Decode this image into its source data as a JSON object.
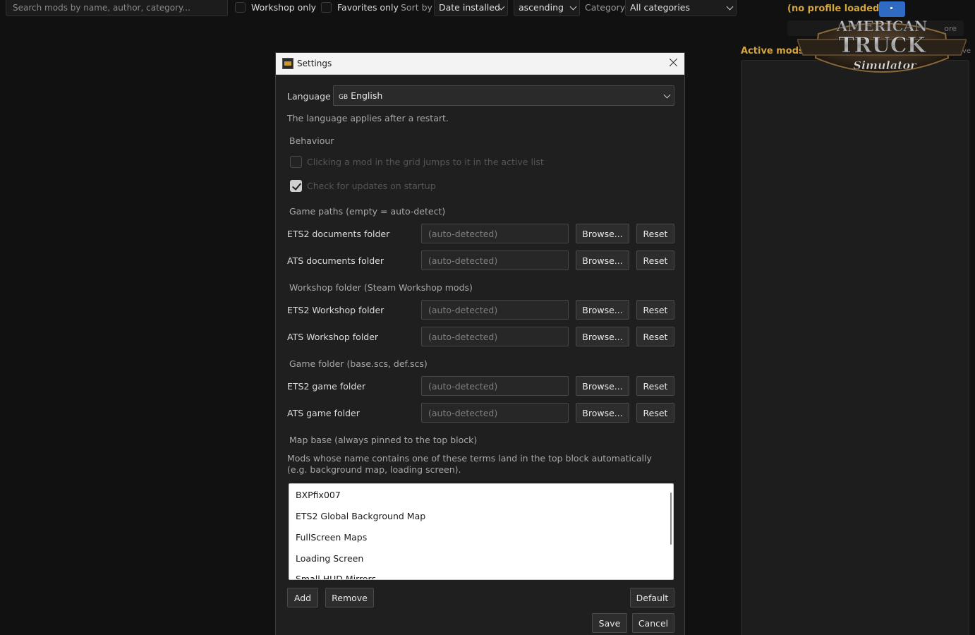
{
  "toolbar": {
    "search_placeholder": "Search mods by name, author, category...",
    "workshop_only": "Workshop only",
    "favorites_only": "Favorites only",
    "sort_by_label": "Sort by",
    "sort_by_value": "Date installed",
    "sort_order_value": "ascending",
    "category_label": "Category",
    "category_value": "All categories"
  },
  "right_panel": {
    "profile_label": "(no profile loaded)",
    "more_button": "ore",
    "active_mods_label": "Active mods",
    "active_truncated": "ve",
    "logo": {
      "line1": "AMERICAN",
      "line2": "TRUCK",
      "line3": "Simulator"
    }
  },
  "dialog": {
    "title": "Settings",
    "language_label": "Language",
    "language_flag": "GB",
    "language_value": "English",
    "language_note": "The language applies after a restart.",
    "behaviour_section": "Behaviour",
    "behaviour_options": [
      {
        "label": "Clicking a mod in the grid jumps to it in the active list",
        "checked": false
      },
      {
        "label": "Check for updates on startup",
        "checked": true
      }
    ],
    "game_paths_section": "Game paths (empty = auto-detect)",
    "workshop_section": "Workshop folder (Steam Workshop mods)",
    "game_folder_section": "Game folder (base.scs, def.scs)",
    "path_rows": [
      {
        "label": "ETS2 documents folder",
        "placeholder": "(auto-detected)"
      },
      {
        "label": "ATS documents folder",
        "placeholder": "(auto-detected)"
      },
      {
        "label": "ETS2 Workshop folder",
        "placeholder": "(auto-detected)"
      },
      {
        "label": "ATS Workshop folder",
        "placeholder": "(auto-detected)"
      },
      {
        "label": "ETS2 game folder",
        "placeholder": "(auto-detected)"
      },
      {
        "label": "ATS game folder",
        "placeholder": "(auto-detected)"
      }
    ],
    "browse_label": "Browse...",
    "reset_label": "Reset",
    "map_base_section": "Map base (always pinned to the top block)",
    "map_base_note": "Mods whose name contains one of these terms land in the top block automatically (e.g. background map, loading screen).",
    "map_terms": [
      "BXPfix007",
      "ETS2 Global Background Map",
      "FullScreen Maps",
      "Loading Screen",
      "Small HUD Mirrors"
    ],
    "add_label": "Add",
    "remove_label": "Remove",
    "default_label": "Default",
    "save_label": "Save",
    "cancel_label": "Cancel"
  }
}
